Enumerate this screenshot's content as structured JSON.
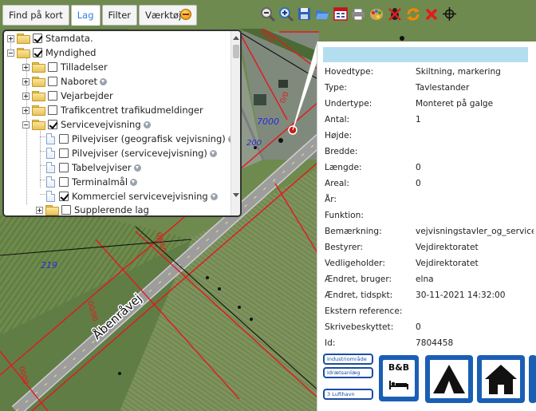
{
  "tabs": [
    {
      "label": "Find på kort",
      "active": false
    },
    {
      "label": "Lag",
      "active": true
    },
    {
      "label": "Filter",
      "active": false
    },
    {
      "label": "Værktøjer",
      "active": false
    }
  ],
  "toolbar_icons": [
    "zoom-out-icon",
    "zoom-in-icon",
    "save-icon",
    "open-folder-icon",
    "window-icon",
    "print-icon",
    "palette-icon",
    "bug-disabled-icon",
    "refresh-icon",
    "delete-icon",
    "crosshair-icon"
  ],
  "layer_tree": [
    {
      "label": "Stamdata.",
      "level": 0,
      "expand": "plus",
      "checked": true,
      "info": false
    },
    {
      "label": "Myndighed",
      "level": 0,
      "expand": "minus",
      "checked": true,
      "info": false
    },
    {
      "label": "Tilladelser",
      "level": 1,
      "expand": "plus",
      "checked": false,
      "info": false
    },
    {
      "label": "Naboret",
      "level": 1,
      "expand": "plus",
      "checked": false,
      "info": true
    },
    {
      "label": "Vejarbejder",
      "level": 1,
      "expand": "plus",
      "checked": false,
      "info": false
    },
    {
      "label": "Trafikcentret trafikudmeldinger",
      "level": 1,
      "expand": "plus",
      "checked": false,
      "info": false
    },
    {
      "label": "Servicevejvisning",
      "level": 1,
      "expand": "minus",
      "checked": true,
      "info": true
    },
    {
      "label": "Pilvejviser (geografisk vejvisning)",
      "level": 2,
      "leaf": true,
      "checked": false,
      "info": true
    },
    {
      "label": "Pilvejviser (servicevejvisning)",
      "level": 2,
      "leaf": true,
      "checked": false,
      "info": true
    },
    {
      "label": "Tabelvejviser",
      "level": 2,
      "leaf": true,
      "checked": false,
      "info": true
    },
    {
      "label": "Terminalmål",
      "level": 2,
      "leaf": true,
      "checked": false,
      "info": true
    },
    {
      "label": "Kommerciel servicevejvisning",
      "level": 2,
      "leaf": true,
      "checked": true,
      "info": true
    },
    {
      "label": "Supplerende lag",
      "level": 1,
      "expand": "plus",
      "checked": false,
      "info": false
    }
  ],
  "map": {
    "road_name": "Åbenråvej",
    "labels": [
      "219",
      "7000",
      "200",
      "0/0",
      "0/000",
      "00/00",
      "0000",
      "00/0"
    ],
    "colors": {
      "road": "#a8a8a8",
      "boundary": "#e5171f",
      "field_dark": "#4f6b35",
      "field_light": "#8ea06b"
    }
  },
  "info_panel": {
    "header": "",
    "attributes": [
      {
        "key": "Hovedtype:",
        "value": "Skiltning, markering"
      },
      {
        "key": "Type:",
        "value": "Tavlestander"
      },
      {
        "key": "Undertype:",
        "value": "Monteret på galge"
      },
      {
        "key": "Antal:",
        "value": "1"
      },
      {
        "key": "Højde:",
        "value": ""
      },
      {
        "key": "Bredde:",
        "value": ""
      },
      {
        "key": "Længde:",
        "value": "0"
      },
      {
        "key": "Areal:",
        "value": "0"
      },
      {
        "key": "År:",
        "value": ""
      },
      {
        "key": "Funktion:",
        "value": ""
      },
      {
        "key": "Bemærkning:",
        "value": "vejvisningstavler_og_servicetavler"
      },
      {
        "key": "Bestyrer:",
        "value": "Vejdirektoratet"
      },
      {
        "key": "Vedligeholder:",
        "value": "Vejdirektoratet"
      },
      {
        "key": "Ændret, bruger:",
        "value": "elna"
      },
      {
        "key": "Ændret, tidspkt:",
        "value": "30-11-2021 14:32:00"
      },
      {
        "key": "Ekstern reference:",
        "value": ""
      },
      {
        "key": "Skrivebeskyttet:",
        "value": "0"
      },
      {
        "key": "Id:",
        "value": "7804458"
      }
    ],
    "signs": {
      "small": [
        "Industriområde",
        "Idrætsanlæg",
        "3    Lufthavn"
      ],
      "bb_label": "B&B"
    }
  }
}
